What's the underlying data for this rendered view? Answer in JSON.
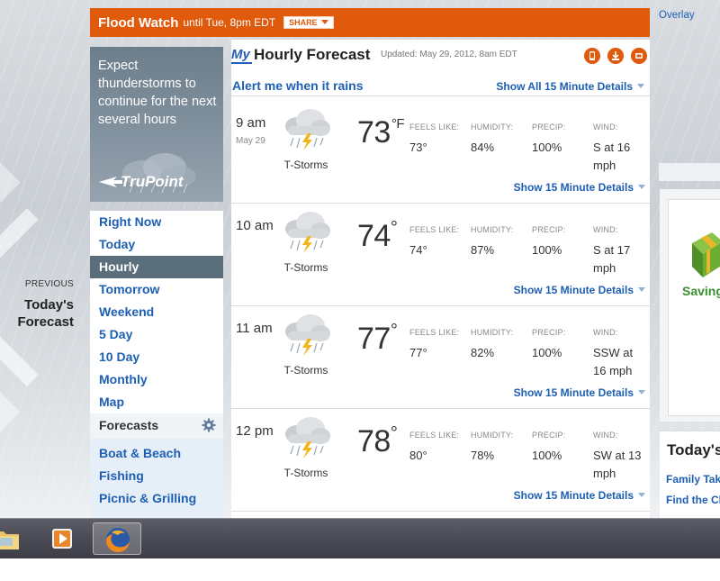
{
  "flood_watch": {
    "title": "Flood Watch",
    "until": "until Tue, 8pm EDT",
    "share_label": "SHARE"
  },
  "promo": {
    "text": "Expect thunderstorms to continue for the next several hours",
    "brand": "TruPoint"
  },
  "previous": {
    "label": "PREVIOUS",
    "title_line1": "Today's",
    "title_line2": "Forecast"
  },
  "nav": {
    "items": [
      {
        "label": "Right Now"
      },
      {
        "label": "Today"
      },
      {
        "label": "Hourly"
      },
      {
        "label": "Tomorrow"
      },
      {
        "label": "Weekend"
      },
      {
        "label": "5 Day"
      },
      {
        "label": "10 Day"
      },
      {
        "label": "Monthly"
      },
      {
        "label": "Map"
      }
    ],
    "active": "Hourly"
  },
  "forecasts": {
    "heading": "Forecasts",
    "items": [
      {
        "label": "Boat & Beach"
      },
      {
        "label": "Fishing"
      },
      {
        "label": "Picnic & Grilling"
      }
    ]
  },
  "main": {
    "my": "My",
    "title": "Hourly Forecast",
    "updated": "Updated: May 29, 2012, 8am EDT",
    "alert": "Alert me when it rains",
    "show_all": "Show All 15 Minute Details",
    "labels": {
      "feels": "FEELS LIKE:",
      "humidity": "HUMIDITY:",
      "precip": "PRECIP:",
      "wind": "WIND:"
    },
    "show_more": "Show 15 Minute Details",
    "unit": "°F",
    "deg": "°",
    "rows": [
      {
        "time": "9 am",
        "date": "May 29",
        "condition": "T-Storms",
        "temp": "73",
        "feels": "73°",
        "humidity": "84%",
        "precip": "100%",
        "wind_line1": "S at 16",
        "wind_line2": "mph"
      },
      {
        "time": "10 am",
        "date": "",
        "condition": "T-Storms",
        "temp": "74",
        "feels": "74°",
        "humidity": "87%",
        "precip": "100%",
        "wind_line1": "S at 17",
        "wind_line2": "mph"
      },
      {
        "time": "11 am",
        "date": "",
        "condition": "T-Storms",
        "temp": "77",
        "feels": "77°",
        "humidity": "82%",
        "precip": "100%",
        "wind_line1": "SSW at",
        "wind_line2": "16 mph"
      },
      {
        "time": "12 pm",
        "date": "",
        "condition": "T-Storms",
        "temp": "78",
        "feels": "80°",
        "humidity": "78%",
        "precip": "100%",
        "wind_line1": "SW at 13",
        "wind_line2": "mph"
      }
    ]
  },
  "right": {
    "overlay": "Overlay",
    "ad_text": "Saving",
    "today_heading": "Today's",
    "today_links": [
      {
        "label": "Family Take"
      },
      {
        "label": "Find the Ch"
      }
    ]
  },
  "taskbar": {
    "apps": [
      {
        "name": "folder-icon"
      },
      {
        "name": "media-player-icon"
      },
      {
        "name": "firefox-icon"
      }
    ]
  },
  "colors": {
    "flood": "#e05a0c",
    "link": "#1d5fb4",
    "nav_active": "#5b6e7c",
    "forecasts_bg": "#e6eef7"
  }
}
